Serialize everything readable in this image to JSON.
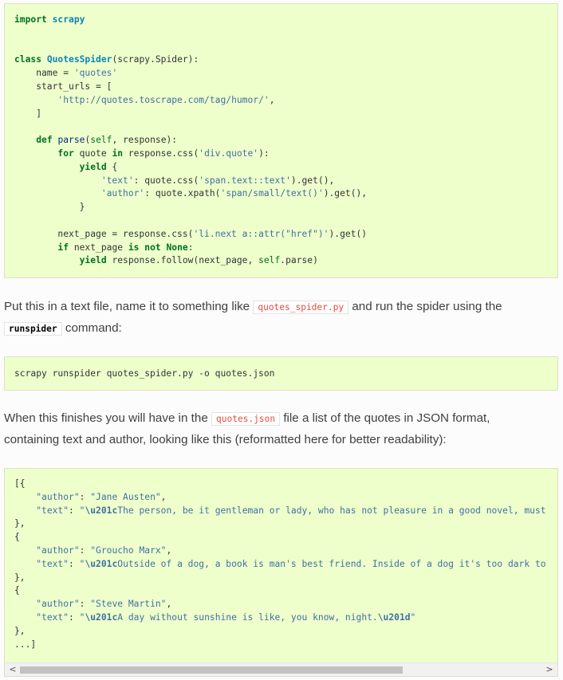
{
  "code1": {
    "l1_import": "import",
    "l1_mod": "scrapy",
    "l4_class": "class",
    "l4_name": "QuotesSpider",
    "l4_rest": "(scrapy.Spider):",
    "l5_a": "    name = ",
    "l5_str": "'quotes'",
    "l6": "    start_urls = [",
    "l7_indent": "        ",
    "l7_str": "'http://quotes.toscrape.com/tag/humor/'",
    "l7_rest": ",",
    "l8": "    ]",
    "l10_indent": "    ",
    "l10_def": "def",
    "l10_fn": "parse",
    "l10_a": "(",
    "l10_self": "self",
    "l10_rest": ", response):",
    "l11_indent": "        ",
    "l11_for": "for",
    "l11_a": " quote ",
    "l11_in": "in",
    "l11_b": " response.css(",
    "l11_str": "'div.quote'",
    "l11_c": "):",
    "l12_indent": "            ",
    "l12_yield": "yield",
    "l12_rest": " {",
    "l13_indent": "                ",
    "l13_key": "'text'",
    "l13_a": ": quote.css(",
    "l13_str": "'span.text::text'",
    "l13_b": ").get(),",
    "l14_indent": "                ",
    "l14_key": "'author'",
    "l14_a": ": quote.xpath(",
    "l14_str": "'span/small/text()'",
    "l14_b": ").get(),",
    "l15": "            }",
    "l17_a": "        next_page = response.css(",
    "l17_str": "'li.next a::attr(\"href\")'",
    "l17_b": ").get()",
    "l18_indent": "        ",
    "l18_if": "if",
    "l18_a": " next_page ",
    "l18_isnot": "is not",
    "l18_sp": " ",
    "l18_none": "None",
    "l18_b": ":",
    "l19_indent": "            ",
    "l19_yield": "yield",
    "l19_a": " response.follow(next_page, ",
    "l19_self": "self",
    "l19_b": ".parse)"
  },
  "para1": {
    "t1": "Put this in a text file, name it to something like ",
    "code1": "quotes_spider.py",
    "t2": " and run the spider using the",
    "code2": "runspider",
    "t3": " command:"
  },
  "code2": {
    "command": "scrapy runspider quotes_spider.py -o quotes.json"
  },
  "para2": {
    "t1": "When this finishes you will have in the ",
    "code1": "quotes.json",
    "t2": " file a list of the quotes in JSON format,",
    "t3": "containing text and author, looking like this (reformatted here for better readability):"
  },
  "code3": {
    "l1": "[{",
    "l2_indent": "    ",
    "l2_key": "\"author\"",
    "l2_a": ": ",
    "l2_str": "\"Jane Austen\"",
    "l2_b": ",",
    "l3_indent": "    ",
    "l3_key": "\"text\"",
    "l3_a": ": ",
    "l3_q": "\"",
    "l3_esc": "\\u201c",
    "l3_str": "The person, be it gentleman or lady, who has not pleasure in a good novel, must",
    "l4": "},",
    "l5": "{",
    "l6_indent": "    ",
    "l6_key": "\"author\"",
    "l6_a": ": ",
    "l6_str": "\"Groucho Marx\"",
    "l6_b": ",",
    "l7_indent": "    ",
    "l7_key": "\"text\"",
    "l7_a": ": ",
    "l7_q": "\"",
    "l7_esc": "\\u201c",
    "l7_str": "Outside of a dog, a book is man's best friend. Inside of a dog it's too dark to",
    "l8": "},",
    "l9": "{",
    "l10_indent": "    ",
    "l10_key": "\"author\"",
    "l10_a": ": ",
    "l10_str": "\"Steve Martin\"",
    "l10_b": ",",
    "l11_indent": "    ",
    "l11_key": "\"text\"",
    "l11_a": ": ",
    "l11_q": "\"",
    "l11_esc": "\\u201c",
    "l11_str": "A day without sunshine is like, you know, night.",
    "l11_esc2": "\\u201d",
    "l11_q2": "\"",
    "l12": "},",
    "l13": "...]"
  },
  "scrollbar": {
    "left_arrow": "<",
    "right_arrow": ">",
    "position": 0.0
  }
}
